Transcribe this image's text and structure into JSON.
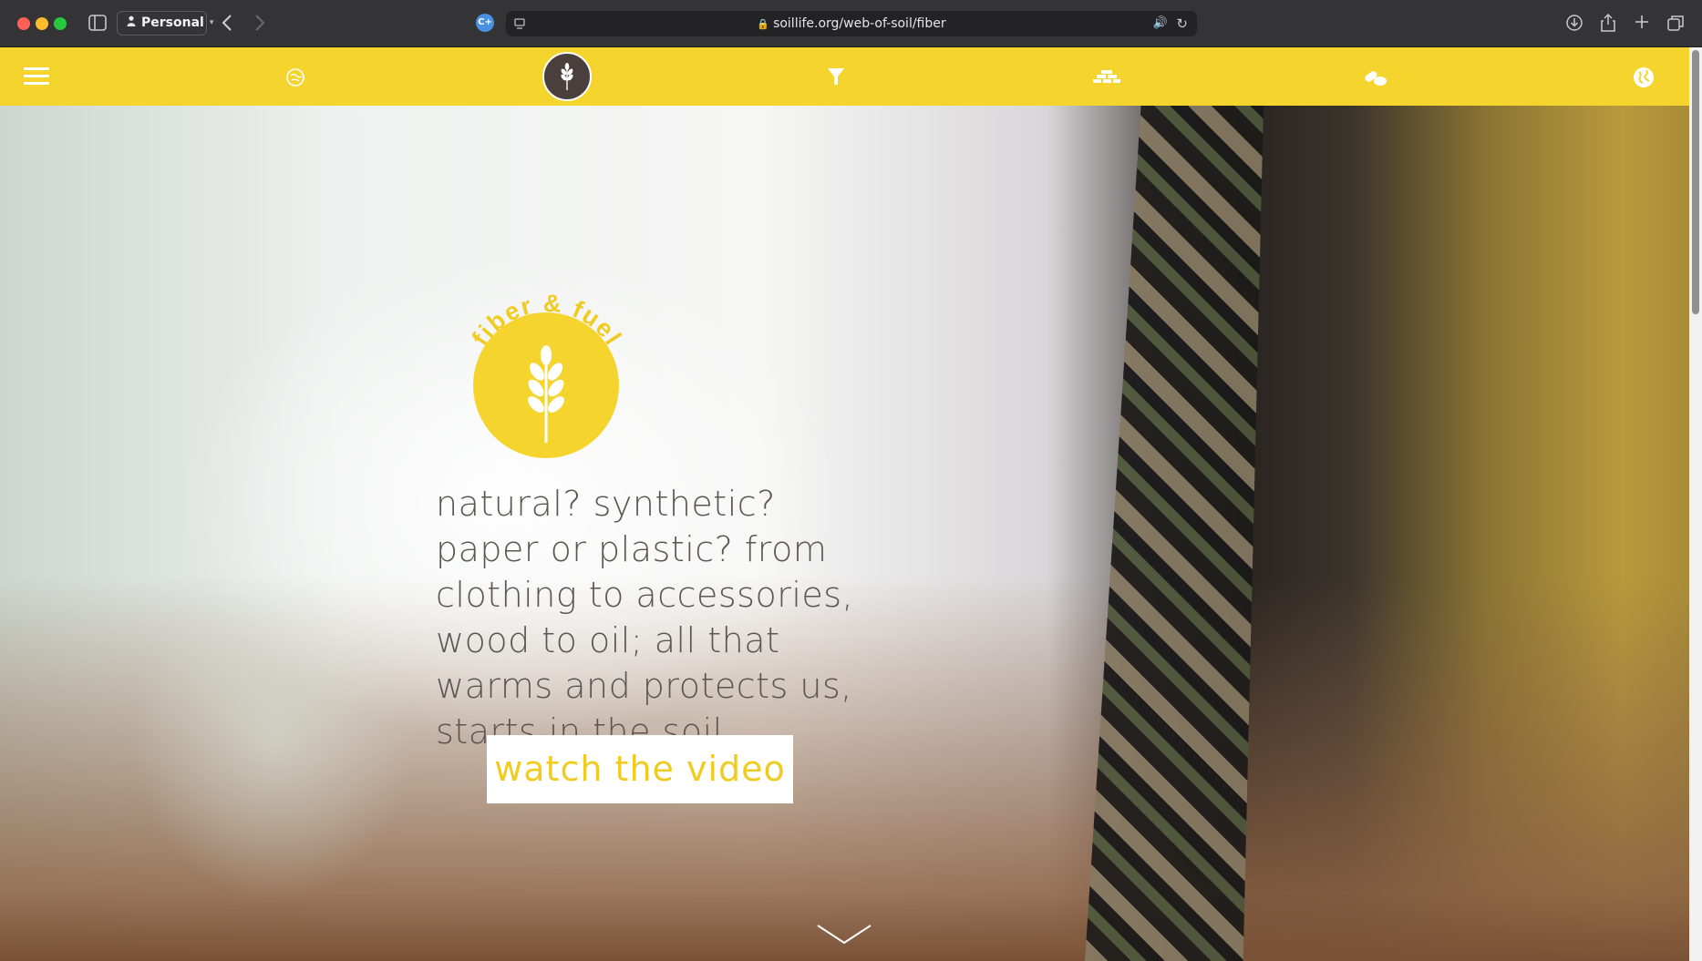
{
  "browser": {
    "profile_label": "Personal",
    "url": "soillife.org/web-of-soil/fiber",
    "extension_badge": "C+"
  },
  "nav": {
    "items": [
      {
        "icon": "hamburger-menu-icon"
      },
      {
        "icon": "soil-ball-icon"
      },
      {
        "icon": "wheat-icon",
        "active": true
      },
      {
        "icon": "filter-funnel-icon"
      },
      {
        "icon": "bricks-icon"
      },
      {
        "icon": "medicine-pills-icon"
      },
      {
        "icon": "globe-icon"
      }
    ],
    "bg_color": "#f5d42e",
    "active_color": "#4a3f3d"
  },
  "hero": {
    "badge_text": "fiber & fuel",
    "headline_lines": [
      "natural? synthetic?",
      "paper or plastic? from",
      "clothing to accessories,",
      "wood to oil; all that",
      "warms and protects us,",
      "starts in the soil."
    ],
    "cta_label": "watch the video",
    "accent_color": "#f0cc23"
  }
}
